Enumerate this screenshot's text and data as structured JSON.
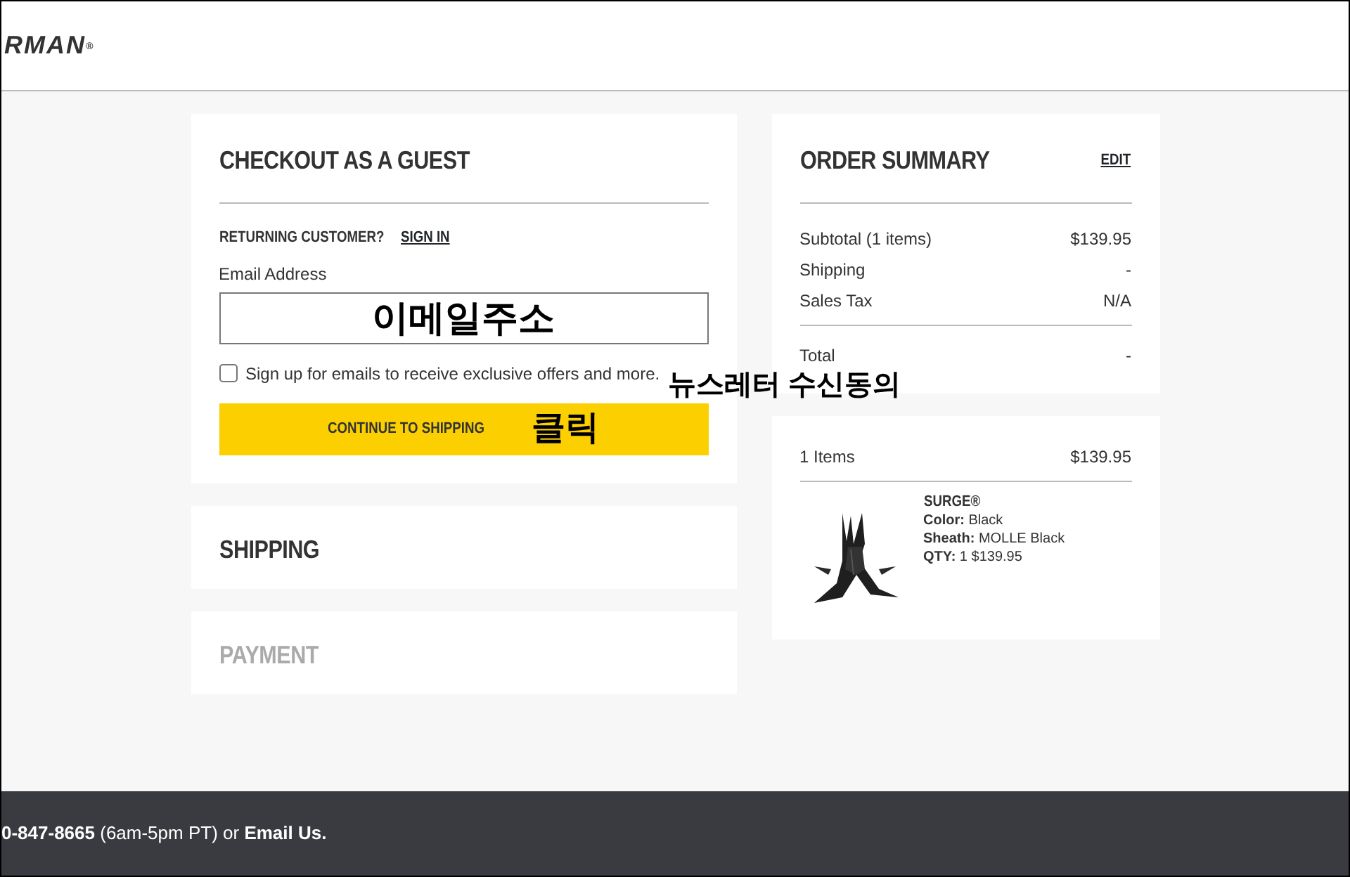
{
  "header": {
    "logo": "RMAN$^{®}$"
  },
  "guest": {
    "title": "CHECKOUT AS A GUEST",
    "returning_label": "RETURNING CUSTOMER?",
    "sign_in": "SIGN IN",
    "email_label": "Email Address",
    "email_value": "이메일주소",
    "newsletter": {
      "label": "Sign up for emails to receive exclusive offers and more.",
      "checked": false,
      "annotation": "뉴스레터 수신동의"
    },
    "button": "CONTINUE TO SHIPPING",
    "button_annotation": "클릭"
  },
  "steps": [
    {
      "title": "SHIPPING",
      "disabled": false
    },
    {
      "title": "PAYMENT",
      "disabled": true
    }
  ],
  "summary": {
    "title": "ORDER SUMMARY",
    "edit": "EDIT",
    "lines": [
      {
        "label": "Subtotal (1 items)",
        "value": "$139.95"
      },
      {
        "label": "Shipping",
        "value": "-"
      },
      {
        "label": "Sales Tax",
        "value": "N/A"
      }
    ],
    "total": {
      "label": "Total",
      "value": "-"
    }
  },
  "items": {
    "count": "1 Items",
    "amount": "$139.95",
    "products": [
      {
        "kind": "picture",
        "name": "SURGE®",
        "details": [
          {
            "label": "Color:",
            "value": "Black"
          },
          {
            "label": "Sheath:",
            "value": "MOLLE Black"
          },
          {
            "label": "QTY:",
            "value": "1  $139.95"
          }
        ]
      }
    ]
  },
  "footer": {
    "text": "**0-847-8665** (6am-5pm PT) or **Email Us.**"
  }
}
